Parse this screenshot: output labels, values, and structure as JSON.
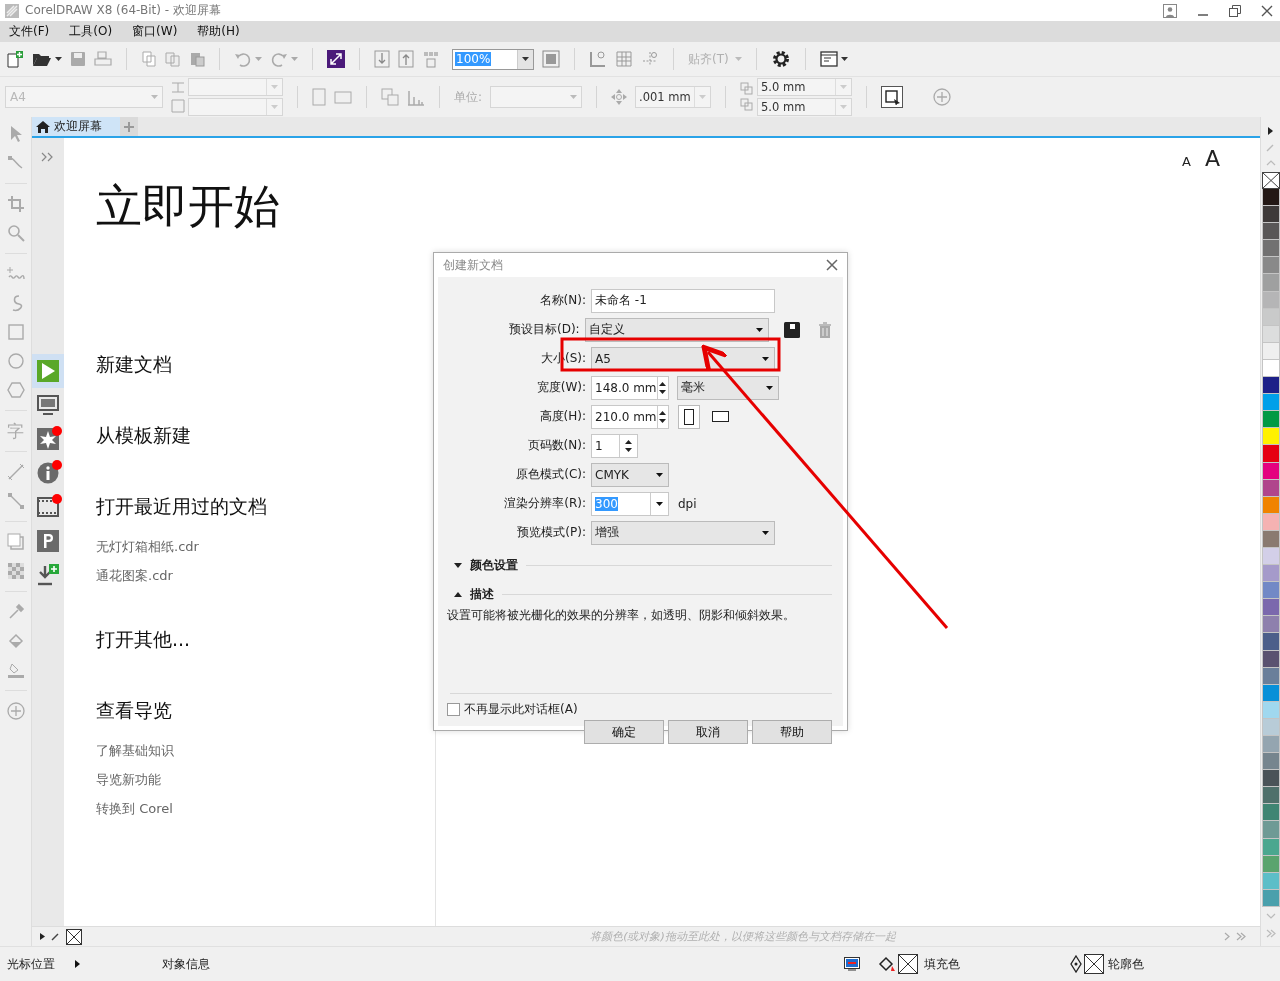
{
  "window": {
    "title": "CorelDRAW X8 (64-Bit) - 欢迎屏幕"
  },
  "menu": [
    "文件(F)",
    "工具(O)",
    "窗口(W)",
    "帮助(H)"
  ],
  "toolbar": {
    "zoom": "100%",
    "snap": {
      "label": "贴齐(T)",
      "disabled": true
    }
  },
  "property_bar": {
    "page_size": {
      "value": "A4",
      "disabled": true
    },
    "units_label": "单位:",
    "nudge": ".001 mm",
    "duplicate_x": "5.0 mm",
    "duplicate_y": "5.0 mm"
  },
  "toolbox": {
    "text_tool_glyph": "字"
  },
  "doc_tabs": [
    {
      "label": "欢迎屏幕",
      "selected": true
    }
  ],
  "welcome": {
    "heading": "立即开始",
    "nav": [
      {
        "kind": "play",
        "selected": true,
        "badge": false
      },
      {
        "kind": "monitor",
        "selected": false,
        "badge": false
      },
      {
        "kind": "star",
        "selected": false,
        "badge": true
      },
      {
        "kind": "info",
        "selected": false,
        "badge": true
      },
      {
        "kind": "film",
        "selected": false,
        "badge": true
      },
      {
        "kind": "p",
        "selected": false,
        "badge": false
      },
      {
        "kind": "download",
        "selected": false,
        "badge": false
      }
    ],
    "sections": [
      {
        "title": "新建文档"
      },
      {
        "title": "从模板新建"
      },
      {
        "title": "打开最近用过的文档",
        "links": [
          "无灯灯箱相纸.cdr",
          "通花图案.cdr"
        ]
      },
      {
        "title": "打开其他..."
      },
      {
        "title": "查看导览",
        "links": [
          "了解基础知识",
          "导览新功能",
          "转换到 Corel"
        ]
      }
    ],
    "font_size_buttons": [
      "A",
      "A"
    ]
  },
  "dialog": {
    "title": "创建新文档",
    "rows": [
      {
        "label": "名称(N):",
        "kind": "text",
        "value": "未命名 -1"
      },
      {
        "label": "预设目标(D):",
        "kind": "combo",
        "value": "自定义",
        "preset_actions": true
      },
      {
        "label": "大小(S):",
        "kind": "combo",
        "value": "A5"
      },
      {
        "label": "宽度(W):",
        "kind": "spin",
        "value": "148.0 mm",
        "unit": "毫米"
      },
      {
        "label": "高度(H):",
        "kind": "spin",
        "value": "210.0 mm",
        "orientation": [
          {
            "kind": "portrait",
            "selected": true
          },
          {
            "kind": "landscape",
            "selected": false
          }
        ]
      },
      {
        "label": "页码数(N):",
        "kind": "spin",
        "value": "1"
      },
      {
        "label": "原色模式(C):",
        "kind": "combo",
        "value": "CMYK"
      },
      {
        "label": "渲染分辨率(R):",
        "kind": "editcombo",
        "value": "300",
        "value_selected": true,
        "suffix": "dpi"
      },
      {
        "label": "预览模式(P):",
        "kind": "combo",
        "value": "增强"
      }
    ],
    "sections": [
      {
        "title": "颜色设置",
        "expanded": false
      },
      {
        "title": "描述",
        "expanded": true
      }
    ],
    "description": "设置可能将被光栅化的效果的分辨率，如透明、阴影和倾斜效果。",
    "dont_show": {
      "label": "不再显示此对话框(A)",
      "checked": false
    },
    "buttons": [
      "确定",
      "取消",
      "帮助"
    ]
  },
  "palette": {
    "swatches": [
      {
        "color": "#231815"
      },
      {
        "color": "#3e3a39"
      },
      {
        "color": "#595757"
      },
      {
        "color": "#727171"
      },
      {
        "color": "#898989"
      },
      {
        "color": "#9fa0a0"
      },
      {
        "color": "#b5b5b6"
      },
      {
        "color": "#c9caca"
      },
      {
        "color": "#dcdddd"
      },
      {
        "color": "#efefef"
      },
      {
        "color": "#ffffff"
      },
      {
        "color": "#1d2088"
      },
      {
        "color": "#00a0e9"
      },
      {
        "color": "#009944"
      },
      {
        "color": "#fff100"
      },
      {
        "color": "#e60012"
      },
      {
        "color": "#e4007f"
      },
      {
        "color": "#b0458c"
      },
      {
        "color": "#f08300"
      },
      {
        "color": "#f5b2b2"
      },
      {
        "color": "#8a7a70"
      },
      {
        "color": "#d3cfe8"
      },
      {
        "color": "#a59aca"
      },
      {
        "color": "#7289c6"
      },
      {
        "color": "#7b68ad"
      },
      {
        "color": "#8e80ad"
      },
      {
        "color": "#4c5f8a"
      },
      {
        "color": "#5a5270"
      },
      {
        "color": "#6a7f9a"
      },
      {
        "color": "#0890d8"
      },
      {
        "color": "#a0d8ef"
      },
      {
        "color": "#b8ccd8"
      },
      {
        "color": "#94a5b0"
      },
      {
        "color": "#76858e"
      },
      {
        "color": "#4a5358"
      },
      {
        "color": "#4f706b"
      },
      {
        "color": "#3f8573"
      },
      {
        "color": "#6e9a95"
      },
      {
        "color": "#4ba78f"
      },
      {
        "color": "#5aa46e"
      },
      {
        "color": "#5cbec8"
      },
      {
        "color": "#4aa0ac"
      }
    ]
  },
  "document_palette": {
    "hint": "将颜色(或对象)拖动至此处，以便将这些颜色与文档存储在一起"
  },
  "status_bar": {
    "cursor_label": "光标位置",
    "object_info": "对象信息",
    "fill_label": "填充色",
    "outline_label": "轮廓色"
  }
}
